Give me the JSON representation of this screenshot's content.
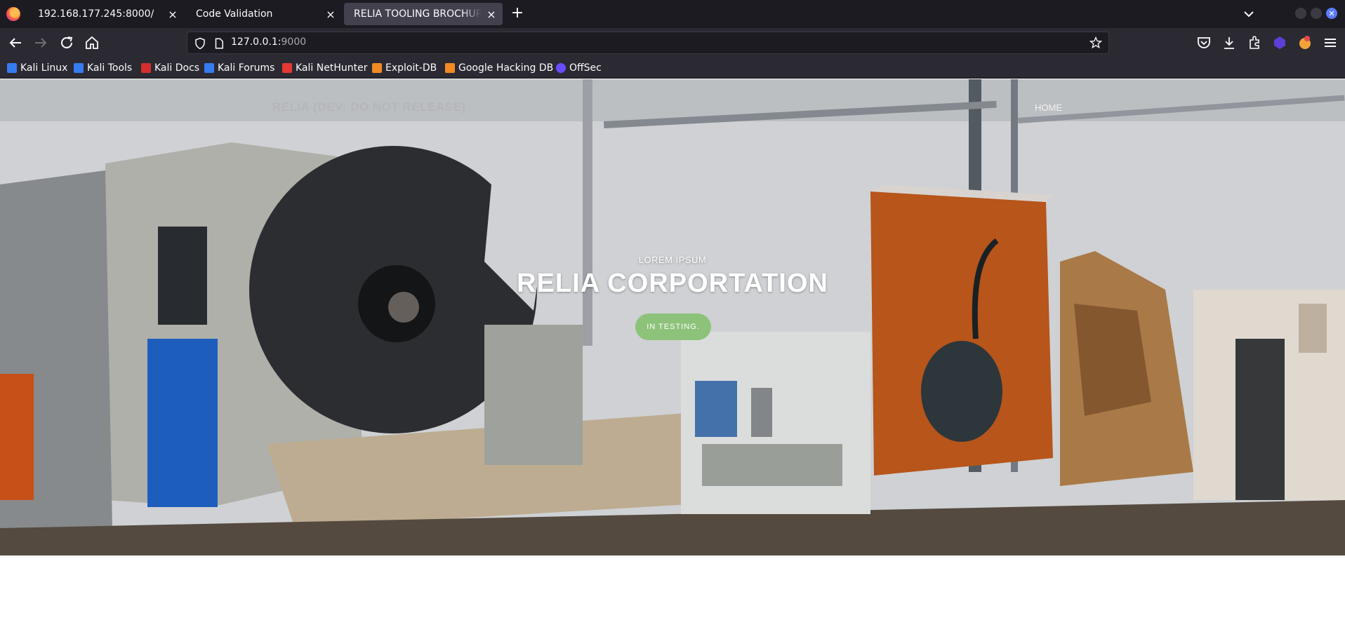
{
  "browser": {
    "tabs": [
      {
        "label": "192.168.177.245:8000/",
        "active": false
      },
      {
        "label": "Code Validation",
        "active": false
      },
      {
        "label": "RELIA TOOLING BROCHURE",
        "active": true
      }
    ],
    "tab_close_glyph": "×",
    "new_tab_glyph": "+",
    "url_host": "127.0.0.1:",
    "url_port": "9000",
    "bookmarks": [
      {
        "label": "Kali Linux",
        "color": "#367bf0"
      },
      {
        "label": "Kali Tools",
        "color": "#367bf0"
      },
      {
        "label": "Kali Docs",
        "color": "#d32f2f"
      },
      {
        "label": "Kali Forums",
        "color": "#367bf0"
      },
      {
        "label": "Kali NetHunter",
        "color": "#e53935"
      },
      {
        "label": "Exploit-DB",
        "color": "#f08a24"
      },
      {
        "label": "Google Hacking DB",
        "color": "#f08a24"
      },
      {
        "label": "OffSec",
        "color": "#6a4cff"
      }
    ],
    "icons": {
      "back": "back-arrow-icon",
      "forward": "forward-arrow-icon",
      "reload": "reload-icon",
      "home": "home-icon",
      "shield": "tracking-shield-icon",
      "page": "page-info-icon",
      "bookmark_star": "star-icon",
      "pocket": "pocket-icon",
      "downloads": "download-icon",
      "extensions": "extensions-icon",
      "menu": "hamburger-menu-icon"
    }
  },
  "site": {
    "brand": "RELIA (DEV: DO NOT RELEASE)",
    "nav_home": "HOME",
    "hero_kicker": "LOREM IPSUM",
    "hero_title": "RELIA CORPORTATION",
    "hero_button": "IN TESTING.",
    "button_color": "#8dc27a"
  }
}
